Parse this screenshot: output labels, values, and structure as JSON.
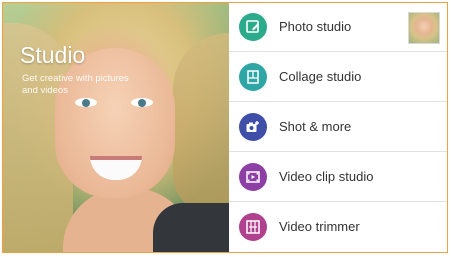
{
  "hero": {
    "title": "Studio",
    "subtitle": "Get creative with pictures and videos"
  },
  "menu": {
    "items": [
      {
        "label": "Photo studio",
        "icon": "photo-edit-icon",
        "color": "#2bab8c"
      },
      {
        "label": "Collage studio",
        "icon": "collage-icon",
        "color": "#2fa6a6"
      },
      {
        "label": "Shot & more",
        "icon": "camera-plus-icon",
        "color": "#3f4fa8"
      },
      {
        "label": "Video clip studio",
        "icon": "film-clip-icon",
        "color": "#8e3fa5"
      },
      {
        "label": "Video trimmer",
        "icon": "film-trim-icon",
        "color": "#b0418f"
      }
    ]
  },
  "colors": {
    "border": "#f0a040",
    "divider": "#e2e2e2"
  }
}
